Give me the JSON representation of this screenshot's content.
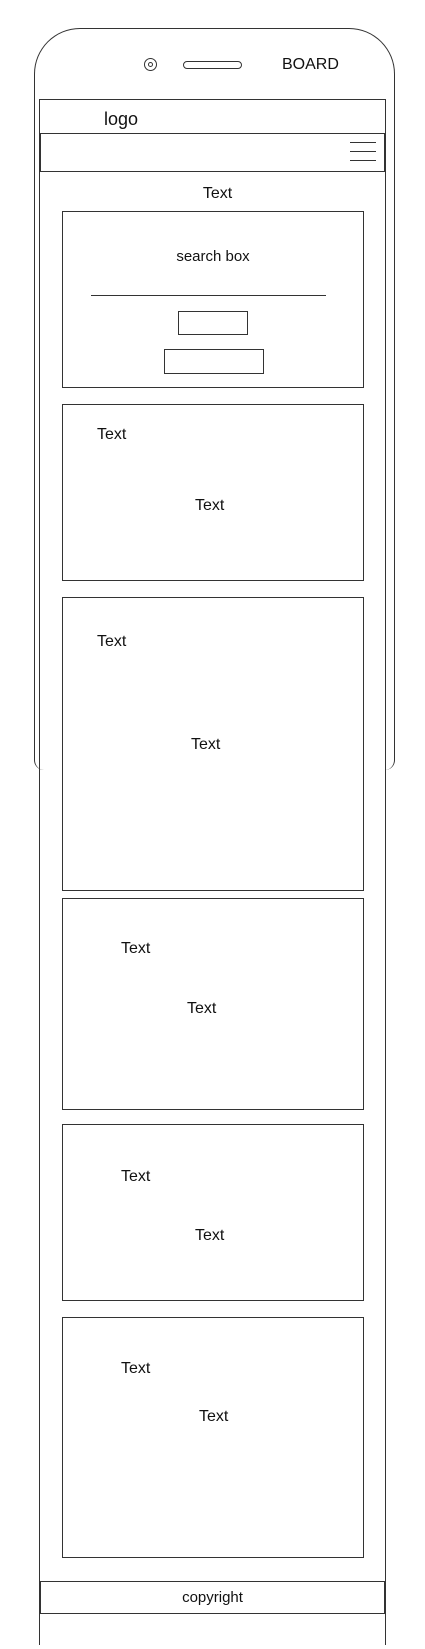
{
  "device": {
    "board_label": "BOARD"
  },
  "header": {
    "logo": "logo",
    "menu_icon": "hamburger-menu-icon"
  },
  "main": {
    "title": "Text",
    "search": {
      "label": "search box"
    },
    "cards": [
      {
        "small": "Text",
        "large": "Text"
      },
      {
        "small": "Text",
        "large": "Text"
      },
      {
        "small": "Text",
        "large": "Text"
      },
      {
        "small": "Text",
        "large": "Text"
      },
      {
        "small": "Text",
        "large": "Text"
      }
    ]
  },
  "footer": {
    "copyright": "copyright"
  }
}
